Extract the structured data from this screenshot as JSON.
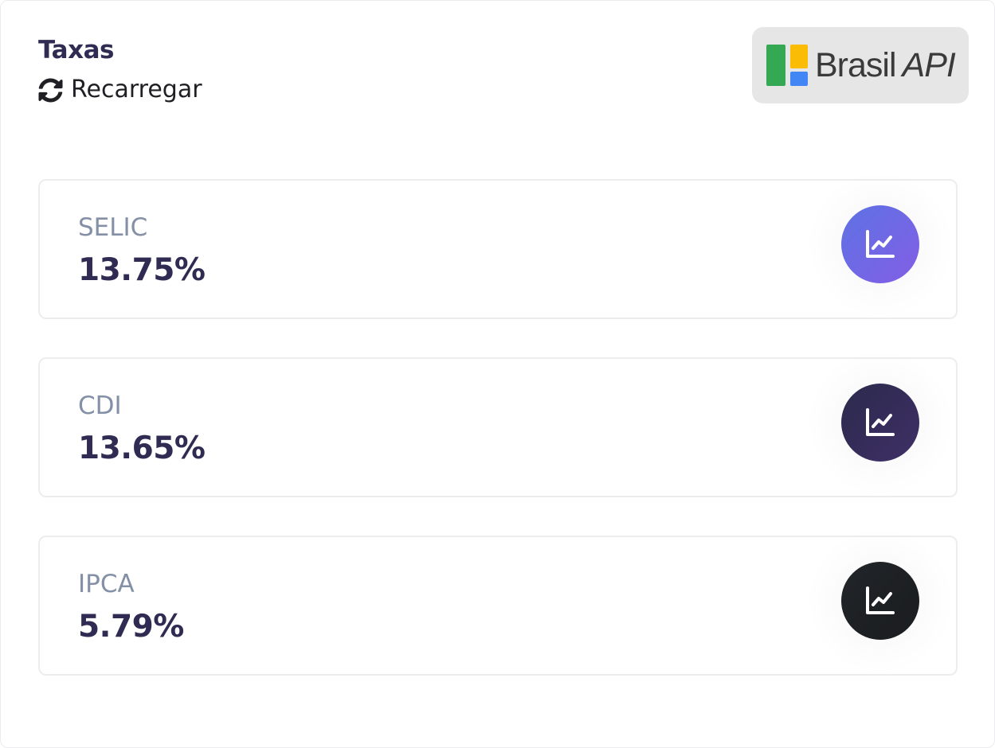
{
  "header": {
    "title": "Taxas",
    "reload_label": "Recarregar"
  },
  "brand": {
    "name": "Brasil",
    "suffix": "API",
    "colors": {
      "green": "#34a853",
      "yellow": "#fbbc05",
      "blue": "#4285f4",
      "text": "#3a3a3a",
      "background": "#e6e6e6"
    }
  },
  "rates": [
    {
      "label": "SELIC",
      "value": "13.75%",
      "icon": "chart-line-icon",
      "icon_gradient": [
        "#5e72e4",
        "#825ee4"
      ]
    },
    {
      "label": "CDI",
      "value": "13.65%",
      "icon": "chart-line-icon",
      "icon_gradient": [
        "#2b2a4c",
        "#3f2f66"
      ]
    },
    {
      "label": "IPCA",
      "value": "5.79%",
      "icon": "chart-line-icon",
      "icon_gradient": [
        "#212529",
        "#1a1c1f"
      ]
    }
  ],
  "colors": {
    "title": "#2f2b52",
    "label": "#8390a6",
    "value": "#2f2b52"
  }
}
